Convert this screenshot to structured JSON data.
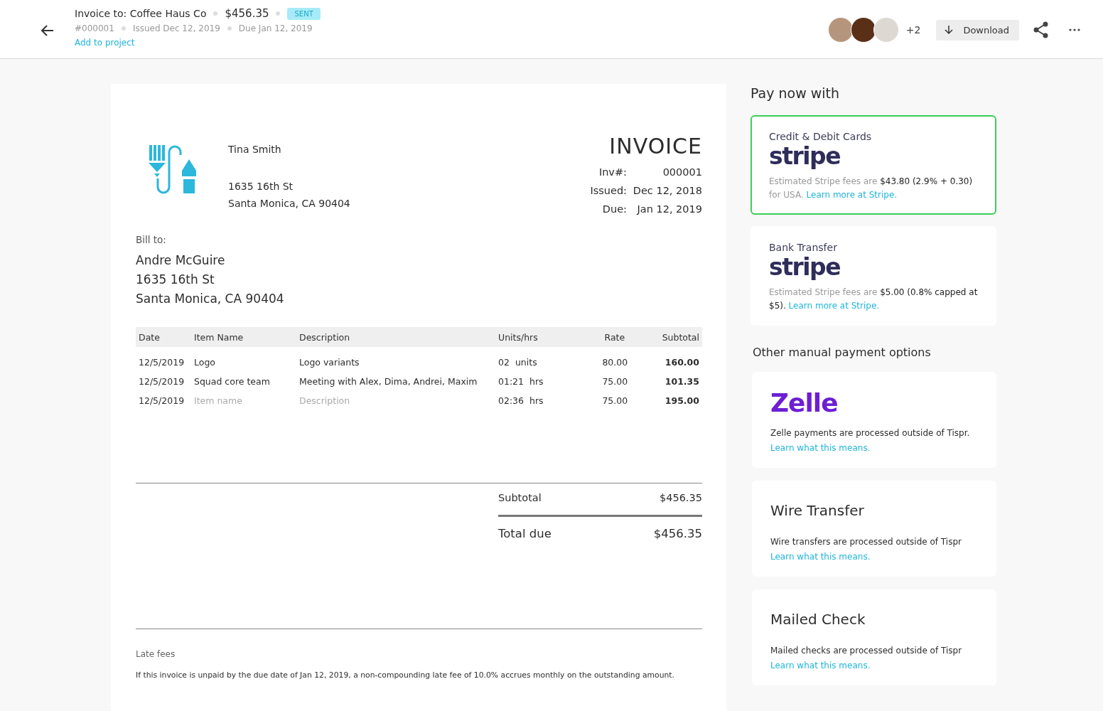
{
  "header": {
    "title": "Invoice to: Coffee Haus Co",
    "amount": "$456.35",
    "status": "SENT",
    "number": "#000001",
    "issued": "Issued Dec 12, 2019",
    "due": "Due Jan 12, 2019",
    "add_link": "Add to project",
    "avatars_more": "+2",
    "download": "Download"
  },
  "invoice": {
    "sender": {
      "name": "Tina Smith",
      "street": "1635 16th St",
      "city": "Santa Monica, CA 90404"
    },
    "heading": "INVOICE",
    "meta": [
      {
        "label": "Inv#:",
        "value": "000001"
      },
      {
        "label": "Issued:",
        "value": "Dec 12, 2018"
      },
      {
        "label": "Due:",
        "value": "Jan 12, 2019"
      }
    ],
    "bill_to_label": "Bill to:",
    "bill_to": [
      "Andre McGuire",
      "1635 16th St",
      "Santa Monica, CA 90404"
    ],
    "columns": [
      "Date",
      "Item Name",
      "Description",
      "Units/hrs",
      "Rate",
      "Subtotal"
    ],
    "rows": [
      {
        "date": "12/5/2019",
        "item": "Logo",
        "description": "Logo variants",
        "qty": "02",
        "unit": "units",
        "rate": "80.00",
        "subtotal": "160.00",
        "placeholder": false
      },
      {
        "date": "12/5/2019",
        "item": "Squad core team",
        "description": "Meeting with Alex, Dima, Andrei, Maxim",
        "qty": "01:21",
        "unit": "hrs",
        "rate": "75.00",
        "subtotal": "101.35",
        "placeholder": false
      },
      {
        "date": "12/5/2019",
        "item": "Item name",
        "description": "Description",
        "qty": "02:36",
        "unit": "hrs",
        "rate": "75.00",
        "subtotal": "195.00",
        "placeholder": true
      }
    ],
    "subtotal_label": "Subtotal",
    "subtotal": "$456.35",
    "total_label": "Total due",
    "total": "$456.35",
    "late_fees_label": "Late fees",
    "late_fees_text": "If this invoice is unpaid by the due date of Jan 12, 2019, a non-compounding late fee of 10.0% accrues monthly on the outstanding amount."
  },
  "pay": {
    "title": "Pay now with",
    "stripe_options": [
      {
        "title": "Credit & Debit Cards",
        "logo": "stripe",
        "text": "Estimated Stripe fees are **$43.80 (2.9% + 0.30)** for USA.",
        "link": "Learn more at Stripe.",
        "selected": true
      },
      {
        "title": "Bank Transfer",
        "logo": "stripe",
        "text": "Estimated Stripe fees are **$5.00 (0.8% capped at $5).**",
        "link": "Learn more at Stripe.",
        "selected": false
      }
    ],
    "manual_title": "Other manual payment options",
    "manual_options": [
      {
        "kind": "logo",
        "title": "Zelle",
        "text": "Zelle payments are processed outside of Tispr.",
        "link": "Learn what this means."
      },
      {
        "kind": "heading",
        "title": "Wire Transfer",
        "text": "Wire transfers are processed outside of Tispr",
        "link": "Learn what this means."
      },
      {
        "kind": "heading",
        "title": "Mailed Check",
        "text": "Mailed checks are processed outside of Tispr",
        "link": "Learn what this means."
      }
    ]
  }
}
